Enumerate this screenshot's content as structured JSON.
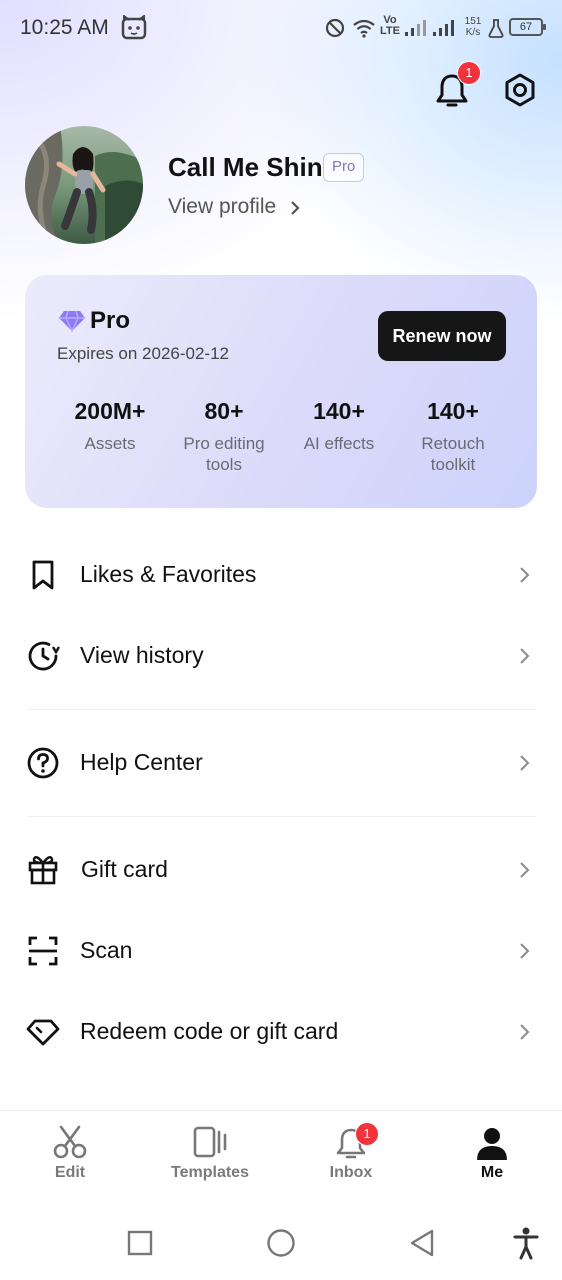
{
  "status_bar": {
    "time": "10:25 AM",
    "network_speed_value": "151",
    "network_speed_unit": "K/s",
    "battery": "67",
    "lte_label_top": "Vo",
    "lte_label_bottom": "LTE"
  },
  "header": {
    "notification_count": "1"
  },
  "profile": {
    "name": "Call Me Shin",
    "badge": "Pro",
    "view_profile": "View profile"
  },
  "pro_card": {
    "title": "Pro",
    "expires": "Expires on 2026-02-12",
    "renew_button": "Renew now",
    "stats": [
      {
        "value": "200M+",
        "label": "Assets"
      },
      {
        "value": "80+",
        "label": "Pro editing tools"
      },
      {
        "value": "140+",
        "label": "AI effects"
      },
      {
        "value": "140+",
        "label": "Retouch toolkit"
      }
    ],
    "accent_color": "#8b7cf6"
  },
  "menu": {
    "likes": "Likes & Favorites",
    "history": "View history",
    "help": "Help Center",
    "gift_card": "Gift card",
    "scan": "Scan",
    "redeem": "Redeem code or gift card"
  },
  "bottom_nav": {
    "edit": "Edit",
    "templates": "Templates",
    "inbox": "Inbox",
    "inbox_badge": "1",
    "me": "Me",
    "active": "Me"
  },
  "icons": [
    "bell-icon",
    "settings-icon",
    "bookmark-icon",
    "history-icon",
    "help-icon",
    "gift-icon",
    "scan-icon",
    "diamond-icon",
    "chevron-right-icon",
    "scissors-icon",
    "templates-icon",
    "person-icon"
  ]
}
